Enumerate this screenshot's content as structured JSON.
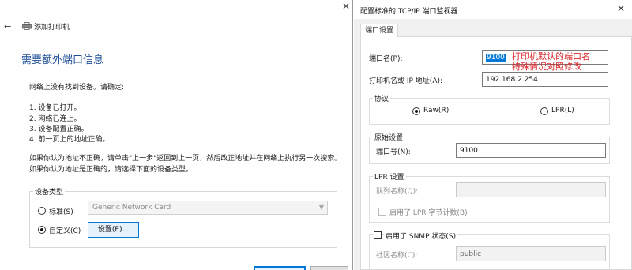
{
  "wizard": {
    "title": "添加打印机",
    "heading": "需要额外端口信息",
    "intro": "网络上没有找到设备。请确定:",
    "checklist": [
      "1.  设备已打开。",
      "2.  网络已连上。",
      "3.  设备配置正确。",
      "4.  前一页上的地址正确。"
    ],
    "hint_line1": "如果你认为地址不正确，请单击\"上一步\"返回到上一页，然后改正地址并在网络上执行另一次搜索。",
    "hint_line2": "如果你认为地址是正确的，请选择下面的设备类型。",
    "device_group_label": "设备类型",
    "standard_label": "标准(S)",
    "standard_value": "Generic Network Card",
    "custom_label": "自定义(C)",
    "settings_button": "设置(E)..."
  },
  "dialog": {
    "title": "配置标准的 TCP/IP 端口监视器",
    "tab": "端口设置",
    "port_name_label": "端口名(P):",
    "port_name_value": "9100",
    "annotation_line1": "打印机默认的端口名",
    "annotation_line2": "特殊情况对照修改",
    "printer_addr_label": "打印机名或 IP 地址(A):",
    "printer_addr_value": "192.168.2.254",
    "protocol_label": "协议",
    "raw_label": "Raw(R)",
    "lpr_label": "LPR(L)",
    "raw_settings_label": "原始设置",
    "port_number_label": "端口号(N):",
    "port_number_value": "9100",
    "lpr_settings_label": "LPR 设置",
    "queue_name_label": "队列名称(Q):",
    "queue_name_value": "",
    "lpr_byte_count_label": "启用了 LPR 字节计数(B)",
    "snmp_label": "启用了 SNMP 状态(S)",
    "community_label": "社区名称(C):",
    "community_value": "public"
  }
}
